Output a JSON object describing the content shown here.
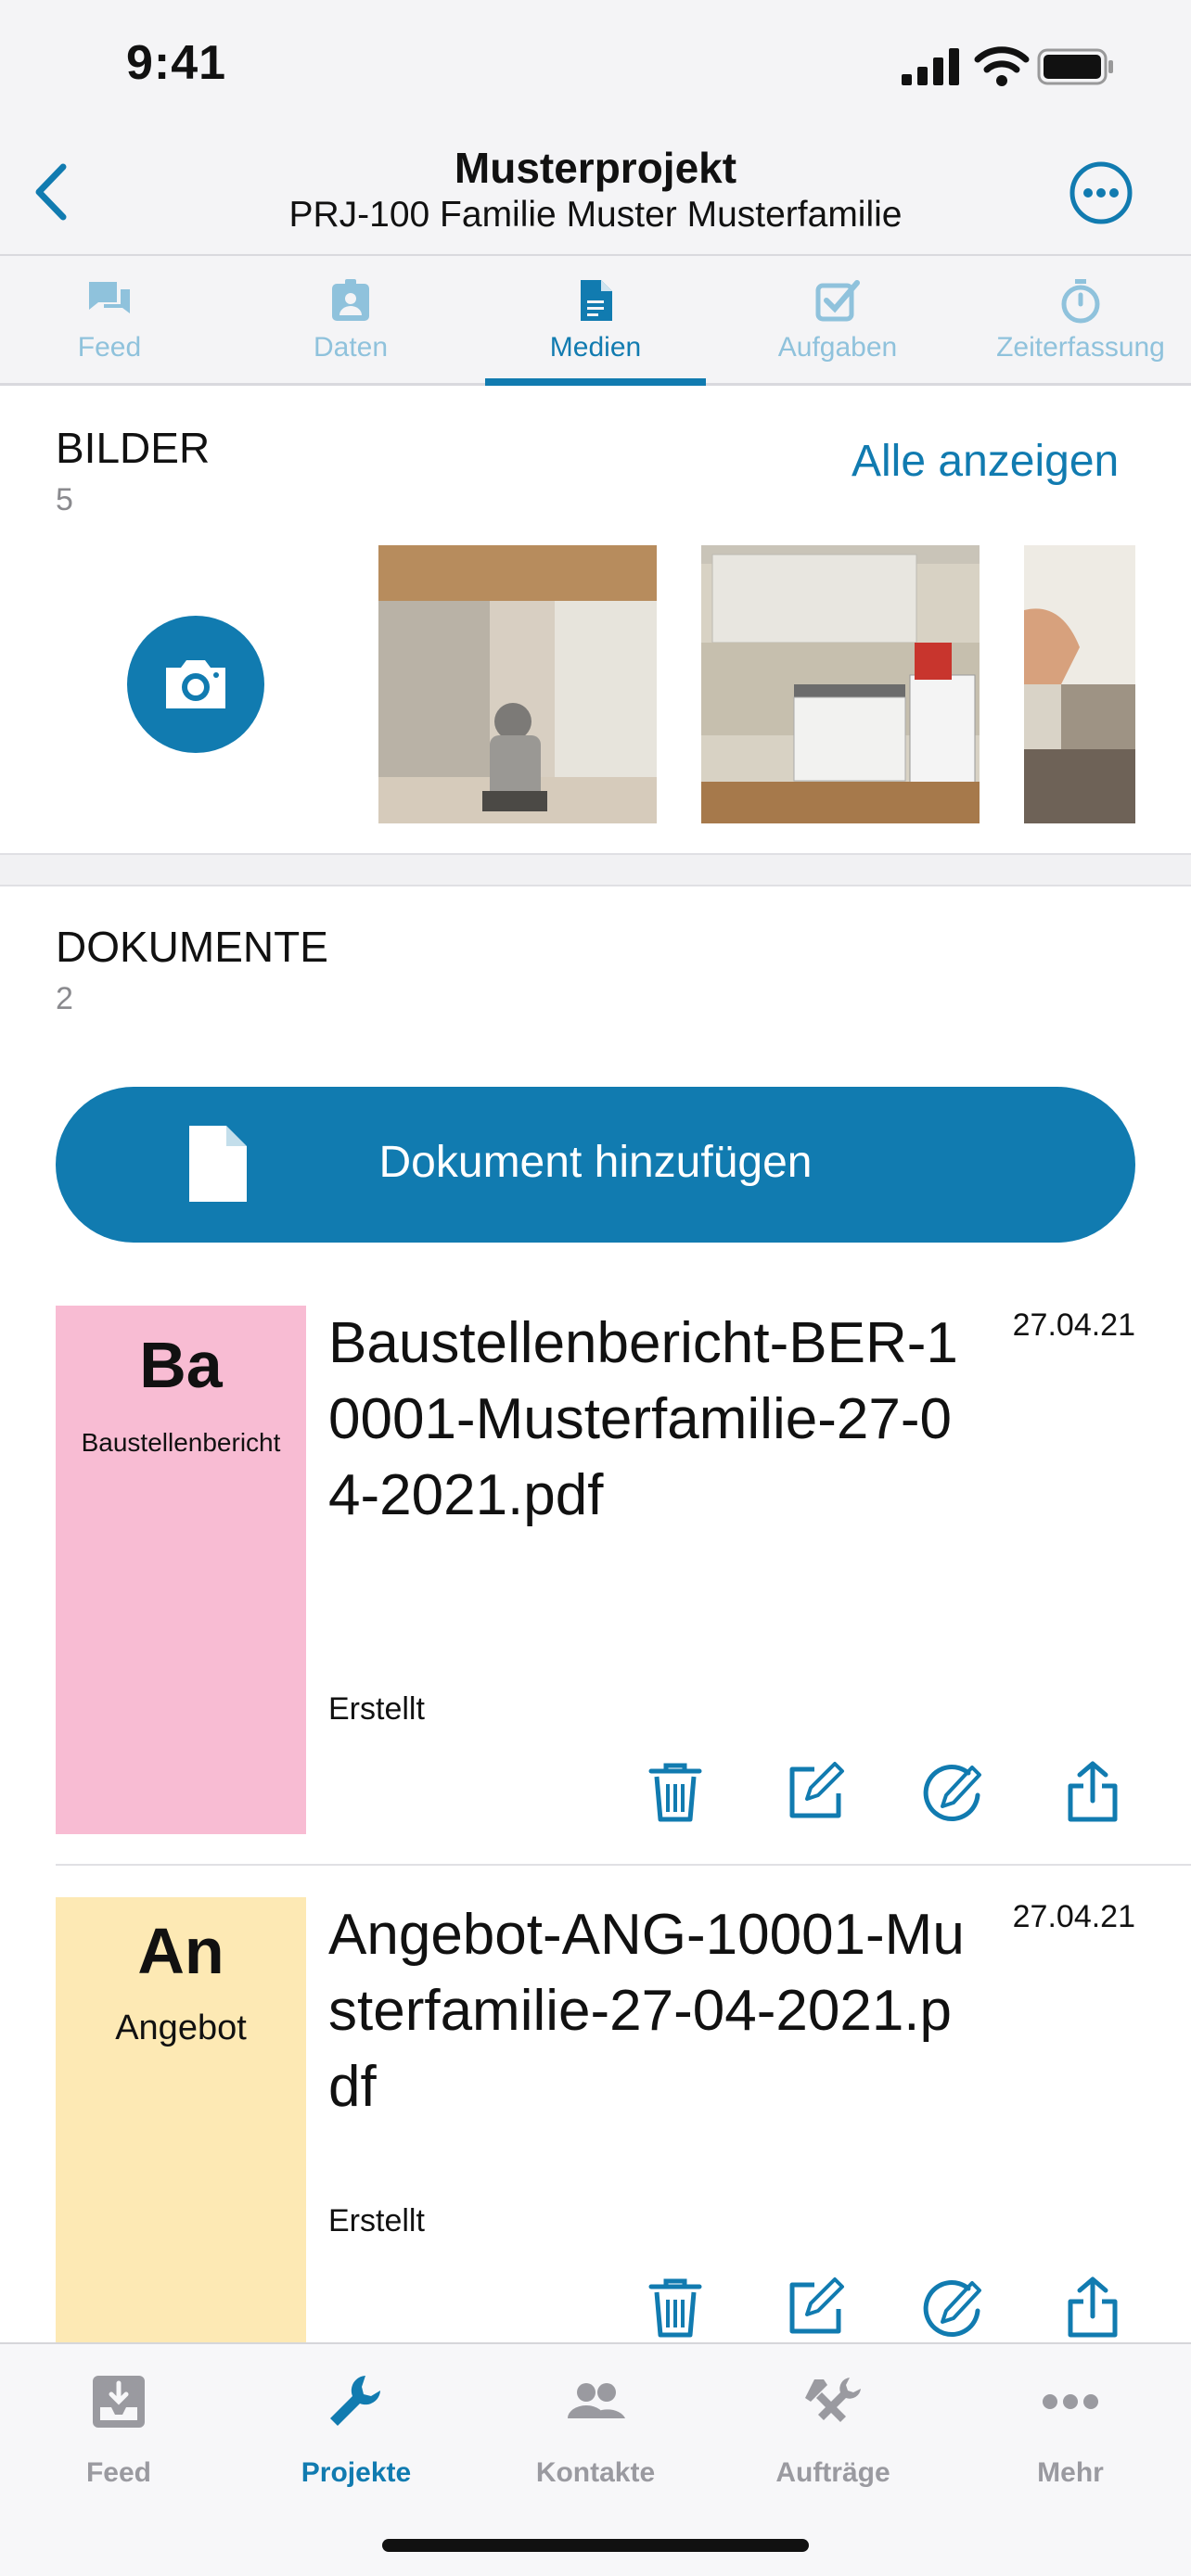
{
  "status": {
    "time": "9:41"
  },
  "nav": {
    "title": "Musterprojekt",
    "subtitle": "PRJ-100 Familie Muster Musterfamilie"
  },
  "segments": [
    {
      "label": "Feed",
      "icon": "chat-icon"
    },
    {
      "label": "Daten",
      "icon": "badge-icon"
    },
    {
      "label": "Medien",
      "icon": "document-icon"
    },
    {
      "label": "Aufgaben",
      "icon": "checkbox-icon"
    },
    {
      "label": "Zeiterfassung",
      "icon": "stopwatch-icon"
    }
  ],
  "active_segment": "Medien",
  "bilder": {
    "title": "BILDER",
    "count": "5",
    "link": "Alle anzeigen"
  },
  "dokumente": {
    "title": "DOKUMENTE",
    "count": "2",
    "add_label": "Dokument hinzufügen"
  },
  "documents": [
    {
      "abbr": "Ba",
      "type": "Baustellenbericht",
      "color": "#f8bcd3",
      "name": "Baustellenbericht-BER-10001-Musterfamilie-27-04-2021.pdf",
      "date": "27.04.21",
      "status": "Erstellt"
    },
    {
      "abbr": "An",
      "type": "Angebot",
      "color": "#fde9b4",
      "name": "Angebot-ANG-10001-Musterfamilie-27-04-2021.pdf",
      "date": "27.04.21",
      "status": "Erstellt"
    }
  ],
  "tabbar": [
    {
      "label": "Feed",
      "icon": "inbox-icon"
    },
    {
      "label": "Projekte",
      "icon": "wrench-icon"
    },
    {
      "label": "Kontakte",
      "icon": "people-icon"
    },
    {
      "label": "Aufträge",
      "icon": "tools-icon"
    },
    {
      "label": "Mehr",
      "icon": "ellipsis-icon"
    }
  ],
  "active_tab": "Projekte",
  "colors": {
    "accent": "#117bb0",
    "inactive": "#9a9aa0"
  }
}
